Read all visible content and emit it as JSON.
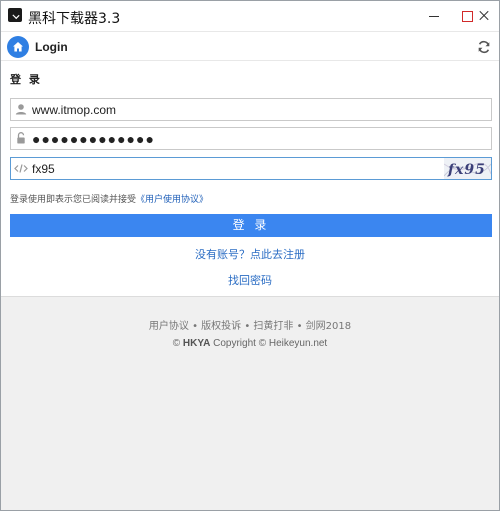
{
  "window": {
    "title": "黑科下载器3.3"
  },
  "header": {
    "title": "Login"
  },
  "form": {
    "section_label": "登 录",
    "username_value": "www.itmop.com",
    "password_value": "●●●●●●●●●●●●●",
    "captcha_value": "fx95",
    "captcha_image_text": "fx95",
    "agree_text": "登录使用即表示您已阅读并接受",
    "agree_link": "《用户使用协议》",
    "login_button": "登 录",
    "register_link": "没有账号？点此去注册",
    "forgot_link": "找回密码"
  },
  "footer": {
    "links": "用户协议 • 版权投诉 • 扫黄打非 • 剑网2018",
    "copyright_prefix": "© ",
    "copyright_brand": "HKYA",
    "copyright_suffix": " Copyright © Heikeyun.net"
  },
  "colors": {
    "accent": "#3b86f0",
    "link": "#2b6dc4"
  },
  "icons": {
    "home": "home-icon",
    "refresh": "refresh-icon",
    "user": "user-icon",
    "lock": "lock-icon",
    "code": "code-icon"
  }
}
